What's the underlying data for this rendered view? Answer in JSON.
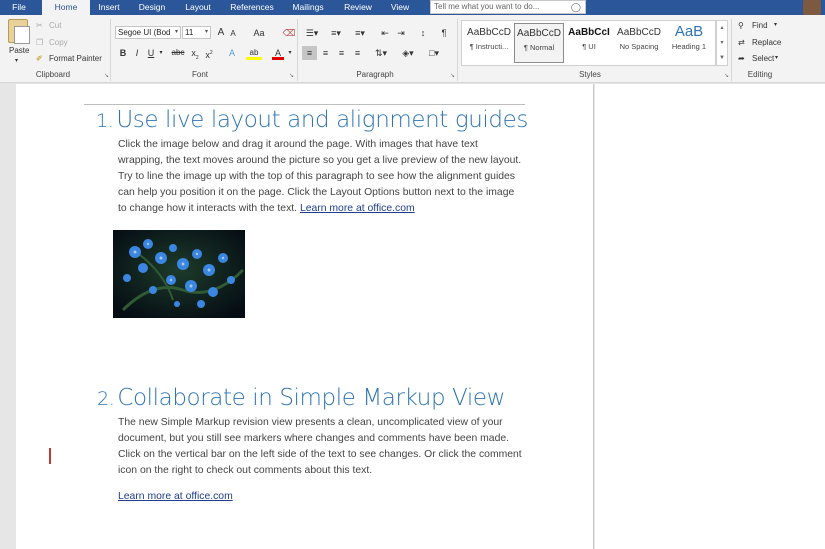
{
  "tabs": [
    {
      "label": "File",
      "active": false
    },
    {
      "label": "Home",
      "active": true
    },
    {
      "label": "Insert",
      "active": false
    },
    {
      "label": "Design",
      "active": false
    },
    {
      "label": "Layout",
      "active": false
    },
    {
      "label": "References",
      "active": false
    },
    {
      "label": "Mailings",
      "active": false
    },
    {
      "label": "Review",
      "active": false
    },
    {
      "label": "View",
      "active": false
    }
  ],
  "tell_me": {
    "placeholder": "Tell me what you want to do..."
  },
  "clipboard": {
    "paste_label": "Paste",
    "cut_label": "Cut",
    "copy_label": "Copy",
    "format_painter_label": "Format Painter",
    "group_label": "Clipboard"
  },
  "font": {
    "family": "Segoe UI (Bod",
    "size": "11",
    "grow_label": "A",
    "shrink_label": "A",
    "change_case_label": "Aa",
    "bold": "B",
    "italic": "I",
    "underline": "U",
    "strike": "abc",
    "subscript": "x",
    "superscript": "x",
    "text_effects": "A",
    "highlight": "ab",
    "font_color": "A",
    "group_label": "Font"
  },
  "paragraph": {
    "group_label": "Paragraph"
  },
  "styles": {
    "items": [
      {
        "preview": "AaBbCcD",
        "name": "¶ Instructi...",
        "selected": false
      },
      {
        "preview": "AaBbCcD",
        "name": "¶ Normal",
        "selected": true
      },
      {
        "preview": "AaBbCcI",
        "name": "¶ UI",
        "selected": false
      },
      {
        "preview": "AaBbCcD",
        "name": "No Spacing",
        "selected": false
      },
      {
        "preview": "AaB",
        "name": "Heading 1",
        "selected": false
      }
    ],
    "group_label": "Styles"
  },
  "editing": {
    "find_label": "Find",
    "replace_label": "Replace",
    "select_label": "Select",
    "group_label": "Editing"
  },
  "document": {
    "section1": {
      "number": "1.",
      "heading": "Use live layout and alignment guides",
      "lines": [
        "Click the image below and drag it around the page. With images that have text",
        "wrapping, the text moves around the picture so you get a live preview of the new layout.",
        "Try to line the image up with the top of this paragraph to see how the alignment guides",
        "can help you position it on the page.  Click the Layout Options button next to the image"
      ],
      "last_line_text": "to change how it interacts with the text. ",
      "link": "Learn more at office.com"
    },
    "section2": {
      "number": "2.",
      "heading": "Collaborate in Simple Markup View",
      "lines": [
        "The new Simple Markup revision view presents a clean, uncomplicated view of your",
        "document, but you still see markers where changes and comments have been made.",
        "Click on the vertical bar on the left side of the text to see changes. Or click the comment",
        "icon on the right to check out comments about this text."
      ],
      "link": "Learn more at office.com"
    }
  },
  "colors": {
    "ribbon_blue": "#2b579a",
    "heading_blue": "#2e74b5",
    "link_blue": "#1f3d8c",
    "change_bar_red": "#c0392b"
  }
}
